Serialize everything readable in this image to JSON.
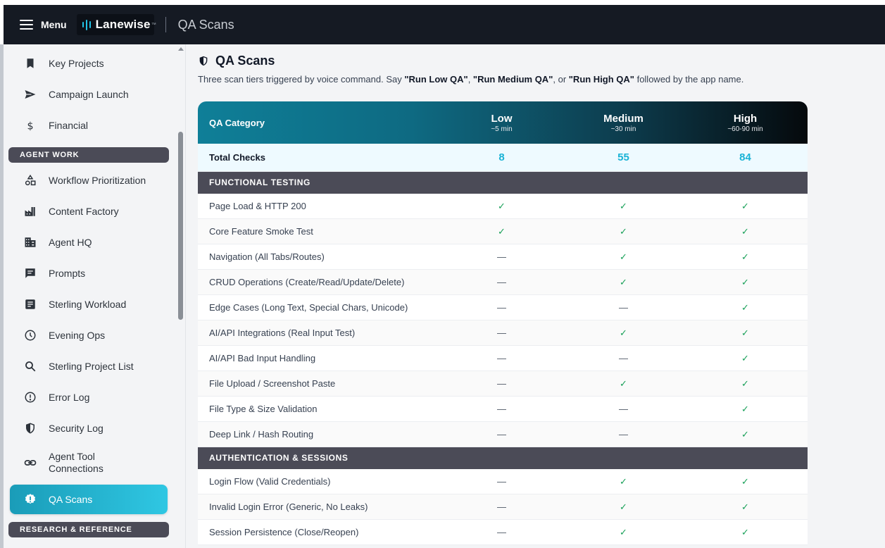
{
  "header": {
    "menu_label": "Menu",
    "brand_name": "Lanewise",
    "brand_tm": "™",
    "app_title": "QA Scans"
  },
  "sidebar": {
    "items_top": [
      {
        "label": "Key Projects",
        "icon": "bookmark-icon"
      },
      {
        "label": "Campaign Launch",
        "icon": "send-icon"
      },
      {
        "label": "Financial",
        "icon": "dollar-icon"
      }
    ],
    "section_agent_work": "AGENT WORK",
    "items_agent": [
      {
        "label": "Workflow Prioritization",
        "icon": "shapes-icon"
      },
      {
        "label": "Content Factory",
        "icon": "factory-icon"
      },
      {
        "label": "Agent HQ",
        "icon": "building-icon"
      },
      {
        "label": "Prompts",
        "icon": "chat-icon"
      },
      {
        "label": "Sterling Workload",
        "icon": "document-icon"
      },
      {
        "label": "Evening Ops",
        "icon": "clock-icon"
      },
      {
        "label": "Sterling Project List",
        "icon": "search-icon"
      },
      {
        "label": "Error Log",
        "icon": "alert-circle-icon"
      },
      {
        "label": "Security Log",
        "icon": "shield-icon"
      },
      {
        "label": "Agent Tool Connections",
        "icon": "link-icon"
      }
    ],
    "active_item": {
      "label": "QA Scans",
      "icon": "badge-alert-icon"
    },
    "section_research": "RESEARCH & REFERENCE"
  },
  "main": {
    "title": "QA Scans",
    "desc_pre": "Three scan tiers triggered by voice command. Say ",
    "cmd_low": "\"Run Low QA\"",
    "desc_sep1": ", ",
    "cmd_medium": "\"Run Medium QA\"",
    "desc_sep2": ", or ",
    "cmd_high": "\"Run High QA\"",
    "desc_post": " followed by the app name."
  },
  "table": {
    "header_category": "QA Category",
    "tiers": [
      {
        "name": "Low",
        "duration": "~5 min"
      },
      {
        "name": "Medium",
        "duration": "~30 min"
      },
      {
        "name": "High",
        "duration": "~60-90 min"
      }
    ],
    "total_label": "Total Checks",
    "totals": [
      "8",
      "55",
      "84"
    ],
    "yes_mark": "✓",
    "no_mark": "—",
    "groups": [
      {
        "title": "FUNCTIONAL TESTING",
        "rows": [
          {
            "label": "Page Load & HTTP 200",
            "checks": [
              true,
              true,
              true
            ]
          },
          {
            "label": "Core Feature Smoke Test",
            "checks": [
              true,
              true,
              true
            ]
          },
          {
            "label": "Navigation (All Tabs/Routes)",
            "checks": [
              false,
              true,
              true
            ]
          },
          {
            "label": "CRUD Operations (Create/Read/Update/Delete)",
            "checks": [
              false,
              true,
              true
            ]
          },
          {
            "label": "Edge Cases (Long Text, Special Chars, Unicode)",
            "checks": [
              false,
              false,
              true
            ]
          },
          {
            "label": "AI/API Integrations (Real Input Test)",
            "checks": [
              false,
              true,
              true
            ]
          },
          {
            "label": "AI/API Bad Input Handling",
            "checks": [
              false,
              false,
              true
            ]
          },
          {
            "label": "File Upload / Screenshot Paste",
            "checks": [
              false,
              true,
              true
            ]
          },
          {
            "label": "File Type & Size Validation",
            "checks": [
              false,
              false,
              true
            ]
          },
          {
            "label": "Deep Link / Hash Routing",
            "checks": [
              false,
              false,
              true
            ]
          }
        ]
      },
      {
        "title": "AUTHENTICATION & SESSIONS",
        "rows": [
          {
            "label": "Login Flow (Valid Credentials)",
            "checks": [
              false,
              true,
              true
            ]
          },
          {
            "label": "Invalid Login Error (Generic, No Leaks)",
            "checks": [
              false,
              true,
              true
            ]
          },
          {
            "label": "Session Persistence (Close/Reopen)",
            "checks": [
              false,
              true,
              true
            ]
          }
        ]
      }
    ]
  }
}
